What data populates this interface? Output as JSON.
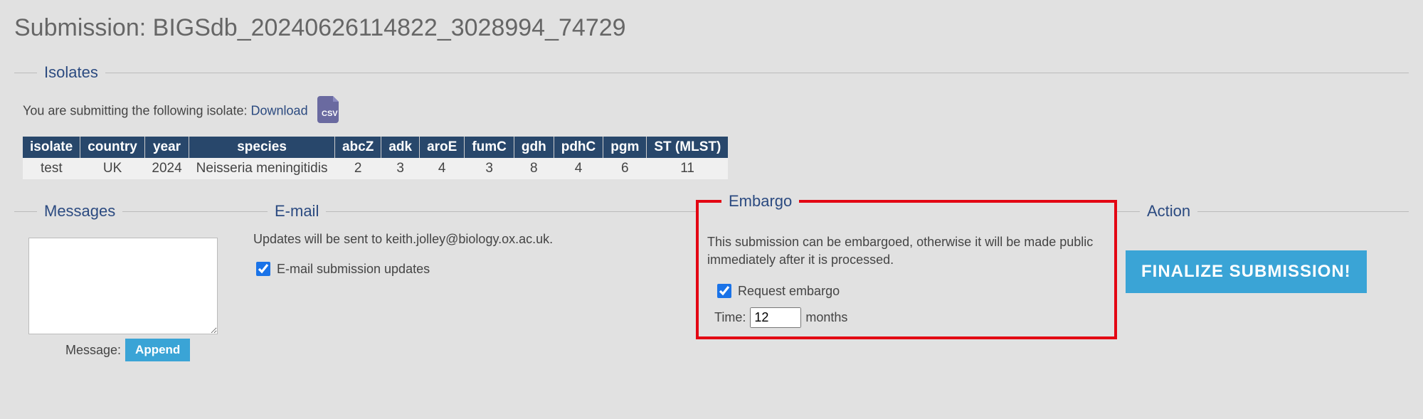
{
  "page_title": "Submission: BIGSdb_20240626114822_3028994_74729",
  "isolates": {
    "legend": "Isolates",
    "intro": "You are submitting the following isolate: ",
    "download_label": "Download",
    "headers": [
      "isolate",
      "country",
      "year",
      "species",
      "abcZ",
      "adk",
      "aroE",
      "fumC",
      "gdh",
      "pdhC",
      "pgm",
      "ST (MLST)"
    ],
    "row": [
      "test",
      "UK",
      "2024",
      "Neisseria meningitidis",
      "2",
      "3",
      "4",
      "3",
      "8",
      "4",
      "6",
      "11"
    ]
  },
  "messages": {
    "legend": "Messages",
    "label": "Message:",
    "append_label": "Append",
    "value": ""
  },
  "email": {
    "legend": "E-mail",
    "info": "Updates will be sent to keith.jolley@biology.ox.ac.uk.",
    "checkbox_label": "E-mail submission updates",
    "checked": true
  },
  "embargo": {
    "legend": "Embargo",
    "info": "This submission can be embargoed, otherwise it will be made public immediately after it is processed.",
    "checkbox_label": "Request embargo",
    "checked": true,
    "time_label": "Time:",
    "time_value": "12",
    "time_unit": "months"
  },
  "action": {
    "legend": "Action",
    "finalize_label": "FINALIZE SUBMISSION!"
  }
}
